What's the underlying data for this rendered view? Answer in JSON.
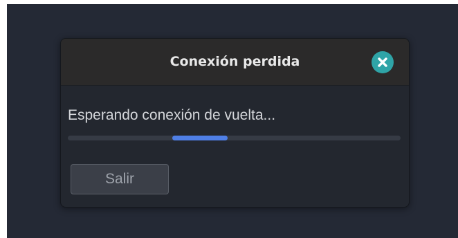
{
  "dialog": {
    "title": "Conexión perdida",
    "close_icon": "close-icon",
    "message": "Esperando conexión de vuelta...",
    "progress": {
      "indeterminate": true
    },
    "exit_label": "Salir"
  },
  "colors": {
    "backdrop": "#242935",
    "dialog_background": "#23272f",
    "titlebar_background": "#2b2a2a",
    "close_button": "#2fa4a7",
    "progress_fill": "#4f7fe6",
    "progress_track": "#363b45",
    "button_background": "#3b3f48"
  }
}
